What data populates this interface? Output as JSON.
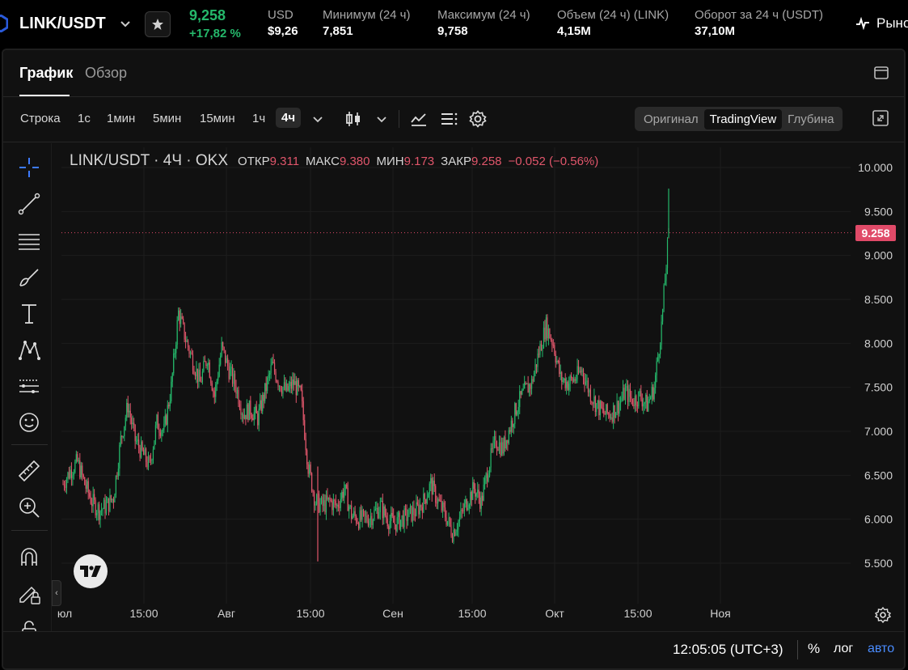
{
  "header": {
    "pair": "LINK/USDT",
    "last_price": "9,258",
    "change_pct": "+17,82 %",
    "stats": [
      {
        "label": "USD",
        "value": "$9,26"
      },
      {
        "label": "Минимум (24 ч)",
        "value": "7,851"
      },
      {
        "label": "Максимум (24 ч)",
        "value": "9,758"
      },
      {
        "label": "Объем (24 ч) (LINK)",
        "value": "4,15M"
      },
      {
        "label": "Оборот за 24 ч (USDT)",
        "value": "37,10M"
      }
    ],
    "markets_label": "Рынок"
  },
  "tabs": [
    {
      "label": "График",
      "active": true
    },
    {
      "label": "Обзор",
      "active": false
    }
  ],
  "toolbar": {
    "timeframes": [
      "Строка",
      "1с",
      "1мин",
      "5мин",
      "15мин",
      "1ч",
      "4ч"
    ],
    "selected_timeframe": "4ч",
    "views": [
      "Оригинал",
      "TradingView",
      "Глубина"
    ],
    "selected_view": "TradingView"
  },
  "legend": {
    "symbol": "LINK/USDT · 4Ч · OKX",
    "open_label": "ОТКР",
    "open": "9.311",
    "high_label": "МАКС",
    "high": "9.380",
    "low_label": "МИН",
    "low": "9.173",
    "close_label": "ЗАКР",
    "close": "9.258",
    "change": "−0.052 (−0.56%)"
  },
  "current_price_tag": "9.258",
  "status_bar": {
    "clock": "12:05:05 (UTC+3)",
    "percent": "%",
    "log": "лог",
    "auto": "авто"
  },
  "colors": {
    "up": "#25b86b",
    "down": "#e0566b",
    "price_line": "#e04a68",
    "accent_blue": "#4a8cff"
  },
  "chart_data": {
    "type": "candlestick",
    "symbol": "LINK/USDT",
    "interval": "4Ч",
    "exchange": "OKX",
    "y_ticks": [
      "10.000",
      "9.500",
      "9.000",
      "8.500",
      "8.000",
      "7.500",
      "7.000",
      "6.500",
      "6.000",
      "5.500"
    ],
    "ylim": [
      5.25,
      10.1
    ],
    "x_ticks": [
      "юл",
      "15:00",
      "Авг",
      "15:00",
      "Сен",
      "15:00",
      "Окт",
      "15:00",
      "Ноя"
    ],
    "grid": true,
    "close_path": [
      6.4,
      6.55,
      6.65,
      6.4,
      6.2,
      6.1,
      6.15,
      6.25,
      6.9,
      7.3,
      6.9,
      6.75,
      6.6,
      7.1,
      7.0,
      7.5,
      8.35,
      8.05,
      7.8,
      7.55,
      7.85,
      7.4,
      7.95,
      7.7,
      7.5,
      7.2,
      7.25,
      7.15,
      7.45,
      7.75,
      7.55,
      7.45,
      7.55,
      7.4,
      6.6,
      6.2,
      6.15,
      6.2,
      6.15,
      6.35,
      6.05,
      6.0,
      6.0,
      6.05,
      6.15,
      6.0,
      5.95,
      6.0,
      6.05,
      6.1,
      6.2,
      6.4,
      6.2,
      6.05,
      5.85,
      6.0,
      6.2,
      6.35,
      6.2,
      6.6,
      6.9,
      6.8,
      7.05,
      7.3,
      7.45,
      7.55,
      7.9,
      8.2,
      8.0,
      7.6,
      7.55,
      7.6,
      7.7,
      7.45,
      7.3,
      7.2,
      7.2,
      7.3,
      7.45,
      7.35,
      7.4,
      7.3,
      7.5,
      8.2,
      9.258
    ],
    "last": {
      "open": 9.311,
      "high": 9.38,
      "low": 9.173,
      "close": 9.258
    }
  }
}
